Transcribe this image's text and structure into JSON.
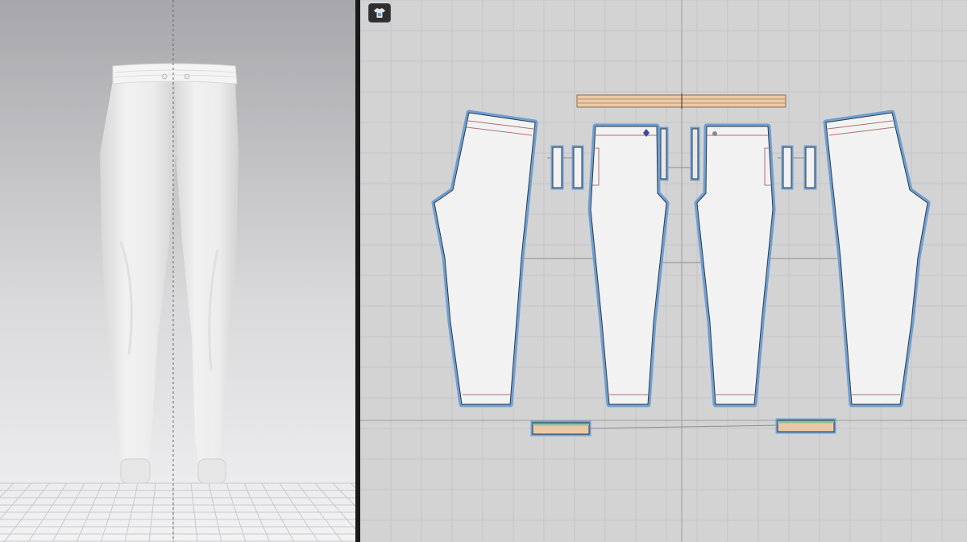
{
  "app": {
    "views": [
      {
        "id": "3d-window",
        "kind": "3D avatar view"
      },
      {
        "id": "2d-window",
        "kind": "2D pattern view"
      }
    ]
  },
  "toolbar": {
    "mode_toggle_icon": "shirt-icon"
  },
  "garment": {
    "type": "jogger-pants",
    "color": "#efefef"
  },
  "pattern": {
    "piece_fill": "#f2f2f3",
    "selection_outline": "#6e9fd2",
    "band_fill": "#ecc9a6",
    "cuff_stripe": "#8fbf9e",
    "pieces": [
      {
        "name": "back-left-leg"
      },
      {
        "name": "front-left-leg"
      },
      {
        "name": "front-right-leg"
      },
      {
        "name": "back-right-leg"
      },
      {
        "name": "waistband"
      },
      {
        "name": "pocket-bag-1"
      },
      {
        "name": "pocket-bag-2"
      },
      {
        "name": "pocket-bag-3"
      },
      {
        "name": "pocket-bag-4"
      },
      {
        "name": "fly-left"
      },
      {
        "name": "fly-right"
      },
      {
        "name": "cuff-left"
      },
      {
        "name": "cuff-right"
      }
    ]
  }
}
